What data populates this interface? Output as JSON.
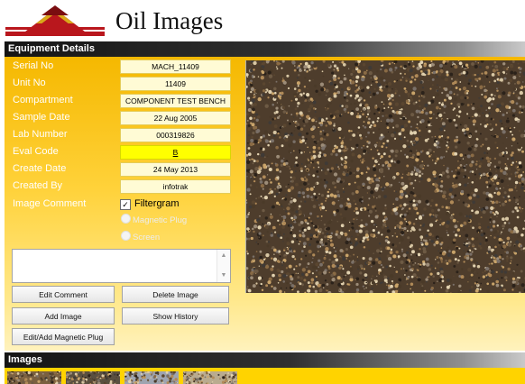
{
  "app": {
    "title": "Oil Images"
  },
  "details_section": {
    "title": "Equipment Details",
    "fields": [
      {
        "label": "Serial No",
        "value": "MACH_11409"
      },
      {
        "label": "Unit No",
        "value": "11409"
      },
      {
        "label": "Compartment",
        "value": "COMPONENT TEST BENCH"
      },
      {
        "label": "Sample Date",
        "value": "22 Aug 2005"
      },
      {
        "label": "Lab Number",
        "value": "000319826"
      },
      {
        "label": "Eval Code",
        "value": "B"
      },
      {
        "label": "Create Date",
        "value": "24 May 2013"
      },
      {
        "label": "Created By",
        "value": "infotrak"
      }
    ],
    "image_comment": {
      "label": "Image Comment",
      "options": [
        {
          "label": "Filtergram",
          "checked": true
        },
        {
          "label": "Magnetic Plug",
          "enabled": false
        },
        {
          "label": "Screen",
          "enabled": false
        }
      ],
      "comment_value": ""
    },
    "buttons": {
      "edit_comment": "Edit Comment",
      "delete_image": "Delete Image",
      "add_image": "Add Image",
      "show_history": "Show History",
      "edit_magnetic_plug": "Edit/Add Magnetic Plug"
    }
  },
  "images_section": {
    "title": "Images",
    "thumbnail_count": 4
  },
  "colors": {
    "panel_top": "#f5b800",
    "panel_bottom": "#fff2bd",
    "eval_highlight": "#ffff00",
    "strip": "#ffd300",
    "logo_red": "#b9171d"
  }
}
